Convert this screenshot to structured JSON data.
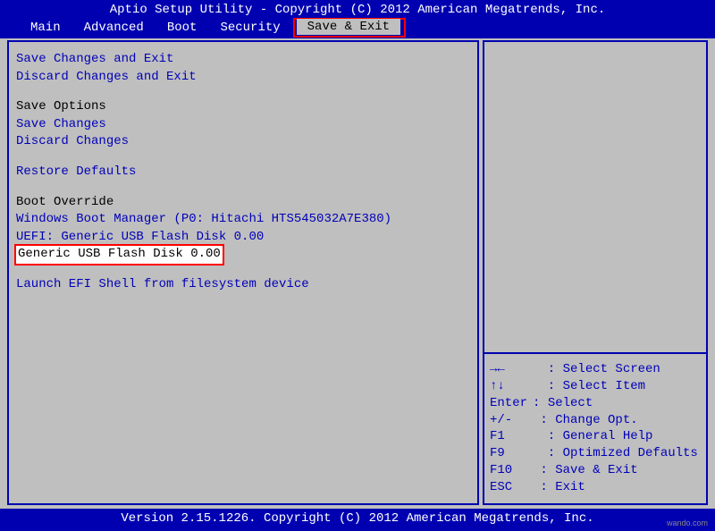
{
  "header": {
    "title": "Aptio Setup Utility - Copyright (C) 2012 American Megatrends, Inc."
  },
  "menu": {
    "items": [
      {
        "label": "Main"
      },
      {
        "label": "Advanced"
      },
      {
        "label": "Boot"
      },
      {
        "label": "Security"
      },
      {
        "label": "Save & Exit",
        "selected": true,
        "highlighted_red": true
      }
    ]
  },
  "left_panel": {
    "items": [
      {
        "text": "Save Changes and Exit",
        "type": "blue"
      },
      {
        "text": "Discard Changes and Exit",
        "type": "blue"
      },
      {
        "text": "",
        "type": "spacer"
      },
      {
        "text": "Save Options",
        "type": "black"
      },
      {
        "text": "Save Changes",
        "type": "blue"
      },
      {
        "text": "Discard Changes",
        "type": "blue"
      },
      {
        "text": "",
        "type": "spacer"
      },
      {
        "text": "Restore Defaults",
        "type": "blue"
      },
      {
        "text": "",
        "type": "spacer"
      },
      {
        "text": "Boot Override",
        "type": "black"
      },
      {
        "text": "Windows Boot Manager (P0: Hitachi HTS545032A7E380)",
        "type": "blue"
      },
      {
        "text": "UEFI: Generic USB Flash Disk 0.00",
        "type": "blue"
      },
      {
        "text": "Generic USB Flash Disk 0.00",
        "type": "highlighted"
      },
      {
        "text": "",
        "type": "spacer"
      },
      {
        "text": "Launch EFI Shell from filesystem device",
        "type": "blue"
      }
    ]
  },
  "help": [
    {
      "key": "→←",
      "sep": "  : ",
      "desc": "Select Screen"
    },
    {
      "key": "↑↓",
      "sep": "  : ",
      "desc": "Select Item"
    },
    {
      "key": "Enter",
      "sep": ": ",
      "desc": "Select"
    },
    {
      "key": "+/-",
      "sep": " : ",
      "desc": "Change Opt."
    },
    {
      "key": "F1",
      "sep": "  : ",
      "desc": "General Help"
    },
    {
      "key": "F9",
      "sep": "  : ",
      "desc": "Optimized Defaults"
    },
    {
      "key": "F10",
      "sep": " : ",
      "desc": "Save & Exit"
    },
    {
      "key": "ESC",
      "sep": " : ",
      "desc": "Exit"
    }
  ],
  "footer": {
    "text": "Version 2.15.1226. Copyright (C) 2012 American Megatrends, Inc."
  },
  "watermark": "wando.com"
}
